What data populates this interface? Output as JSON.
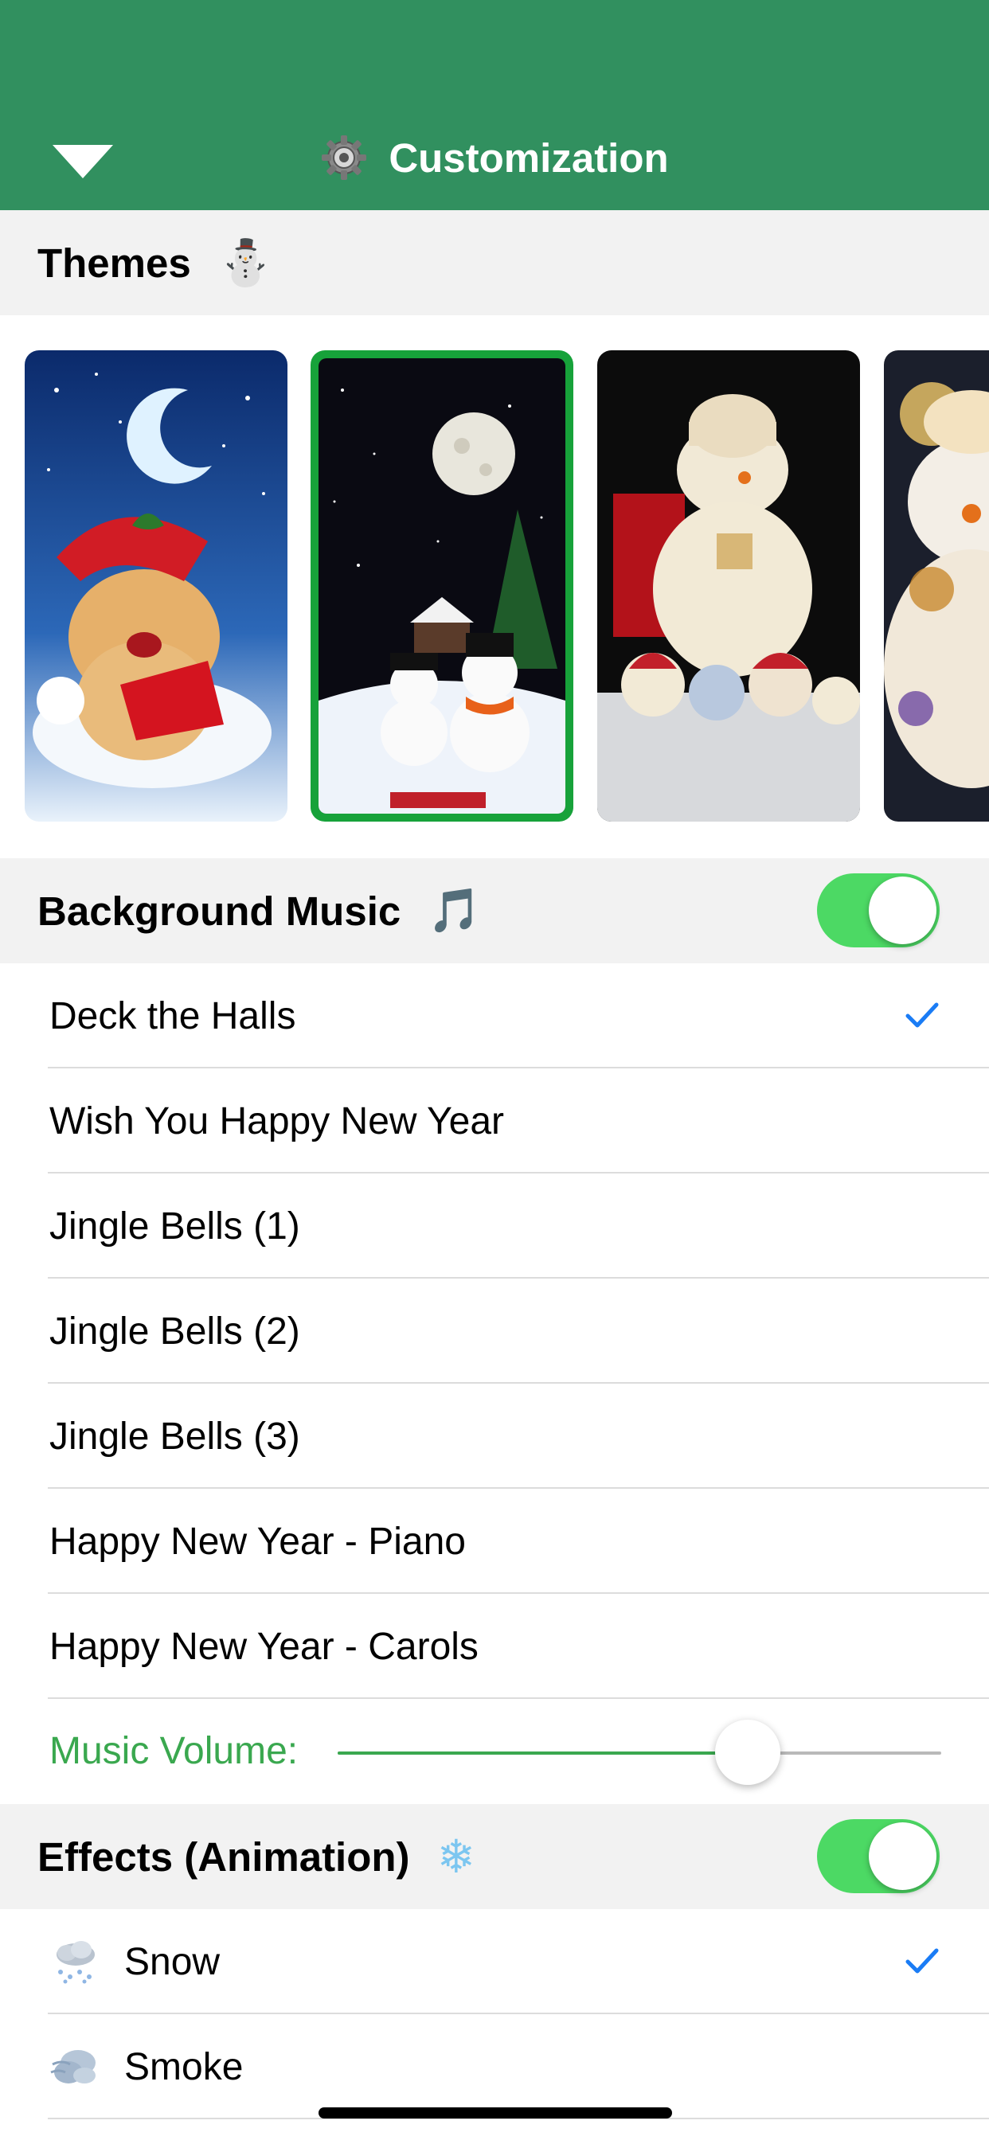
{
  "colors": {
    "brand": "#31905f",
    "toggle_on": "#4cd964",
    "check_blue": "#1a7cf5",
    "volume_green": "#3aa84f",
    "selected_frame": "#17a23a"
  },
  "nav": {
    "title": "Customization",
    "gear_icon": "gear-icon",
    "back_icon": "chevron-down-icon"
  },
  "themes": {
    "title": "Themes",
    "emoji": "⛄",
    "items": [
      {
        "name": "kitten-santa-hat",
        "selected": false
      },
      {
        "name": "snowmen-moon",
        "selected": true
      },
      {
        "name": "snowman-plush",
        "selected": false
      },
      {
        "name": "snowman-ornament",
        "selected": false
      }
    ]
  },
  "music": {
    "title": "Background Music",
    "emoji": "🎵",
    "enabled": true,
    "songs": [
      {
        "label": "Deck the Halls",
        "checked": true
      },
      {
        "label": "Wish You Happy New Year",
        "checked": false
      },
      {
        "label": "Jingle Bells (1)",
        "checked": false
      },
      {
        "label": "Jingle Bells (2)",
        "checked": false
      },
      {
        "label": "Jingle Bells (3)",
        "checked": false
      },
      {
        "label": "Happy New Year - Piano",
        "checked": false
      },
      {
        "label": "Happy New Year - Carols",
        "checked": false
      }
    ],
    "volume_label": "Music Volume:",
    "volume": 0.68
  },
  "effects": {
    "title": "Effects (Animation)",
    "emoji": "❄",
    "enabled": true,
    "items": [
      {
        "label": "Snow",
        "icon": "snow-cloud-icon",
        "checked": true
      },
      {
        "label": "Smoke",
        "icon": "smoke-icon",
        "checked": false
      }
    ]
  }
}
